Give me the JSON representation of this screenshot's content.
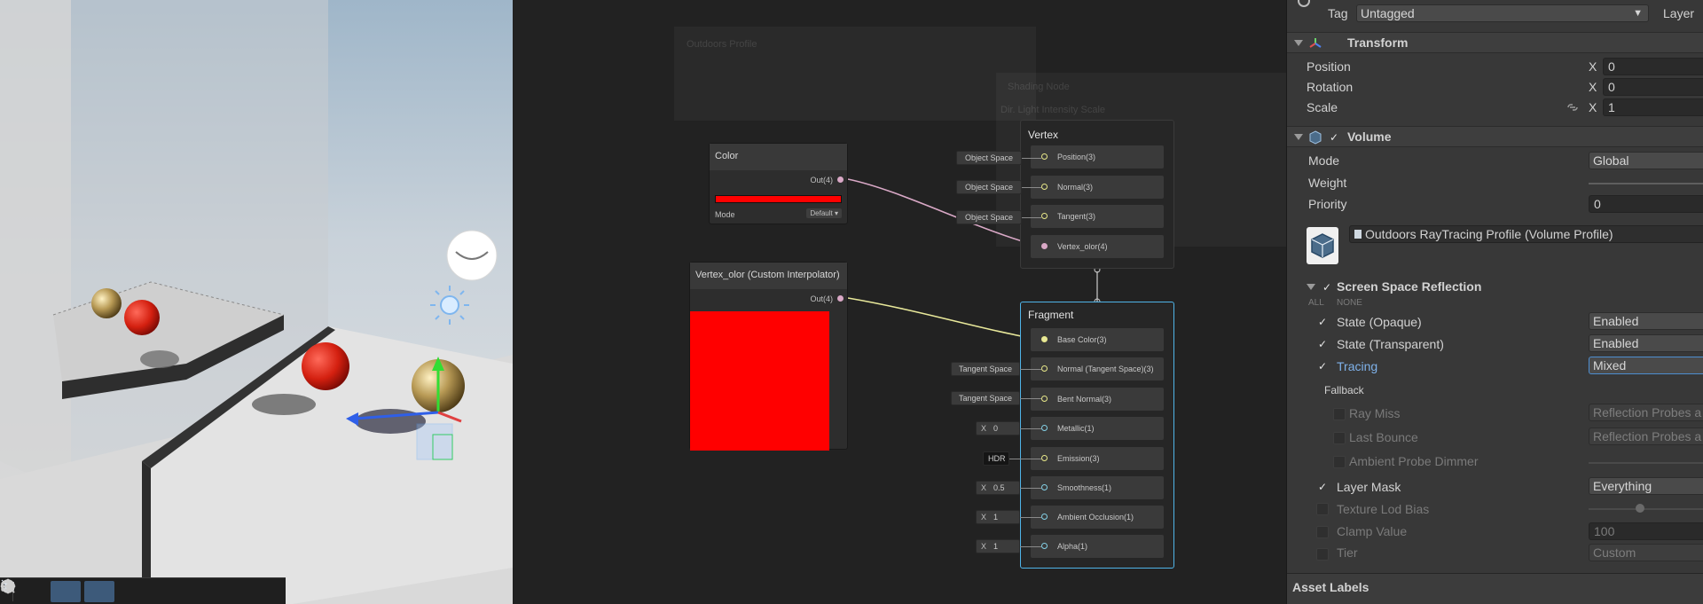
{
  "toolbar": {
    "tools": [
      {
        "icon": "move-view-icon"
      },
      {
        "icon": "sliders-icon"
      },
      {
        "icon": "grid-icon"
      },
      {
        "icon": "shading-icon"
      },
      {
        "icon": "layers-icon"
      },
      {
        "icon": "search-icon"
      },
      {
        "icon": "orbit-icon"
      },
      {
        "icon": "camera-icon"
      }
    ]
  },
  "graph": {
    "ghost_title_1": "Outdoors Profile",
    "ghost_title_2": "Shading Node",
    "ghost_sub": "Dir. Light Intensity Scale",
    "color_node": {
      "title": "Color",
      "out_label": "Out(4)",
      "mode_label": "Mode",
      "mode_value": "Default",
      "swatch_color": "#ff0000"
    },
    "vertex_color_node": {
      "title": "Vertex_olor (Custom Interpolator)",
      "out_label": "Out(4)",
      "preview_color": "#ff0000"
    },
    "vertex_stack": {
      "title": "Vertex",
      "slots": [
        {
          "label": "Position(3)",
          "chip": "Object Space"
        },
        {
          "label": "Normal(3)",
          "chip": "Object Space"
        },
        {
          "label": "Tangent(3)",
          "chip": "Object Space"
        },
        {
          "label": "Vertex_olor(4)",
          "chip": ""
        }
      ]
    },
    "fragment_stack": {
      "title": "Fragment",
      "slots": [
        {
          "label": "Base Color(3)",
          "chip_x": "",
          "chip": ""
        },
        {
          "label": "Normal (Tangent Space)(3)",
          "chip_x": "",
          "chip": "Tangent Space"
        },
        {
          "label": "Bent Normal(3)",
          "chip_x": "",
          "chip": "Tangent Space"
        },
        {
          "label": "Metallic(1)",
          "chip_x": "X",
          "chip": "0"
        },
        {
          "label": "Emission(3)",
          "chip_x": "",
          "chip": "HDR"
        },
        {
          "label": "Smoothness(1)",
          "chip_x": "X",
          "chip": "0.5"
        },
        {
          "label": "Ambient Occlusion(1)",
          "chip_x": "X",
          "chip": "1"
        },
        {
          "label": "Alpha(1)",
          "chip_x": "X",
          "chip": "1"
        }
      ]
    },
    "colors": {
      "accent": "#4fb4e8",
      "wire_color": "#d9a8c6",
      "wire_float": "#e8e89a"
    }
  },
  "inspector": {
    "tag_label": "Tag",
    "tag_value": "Untagged",
    "layer_label": "Layer",
    "transform": {
      "title": "Transform",
      "rows": [
        {
          "label": "Position",
          "axis": "X",
          "value": "0"
        },
        {
          "label": "Rotation",
          "axis": "X",
          "value": "0"
        },
        {
          "label": "Scale",
          "axis": "X",
          "value": "1"
        }
      ]
    },
    "volume": {
      "title": "Volume",
      "mode_label": "Mode",
      "mode_value": "Global",
      "weight_label": "Weight",
      "priority_label": "Priority",
      "priority_value": "0",
      "profile_value": "Outdoors RayTracing Profile (Volume Profile)"
    },
    "ssr": {
      "title": "Screen Space Reflection",
      "all_label": "ALL",
      "none_label": "NONE",
      "fallback_label": "Fallback",
      "rows": [
        {
          "label": "State (Opaque)",
          "value": "Enabled"
        },
        {
          "label": "State (Transparent)",
          "value": "Enabled"
        },
        {
          "label": "Tracing",
          "value": "Mixed"
        },
        {
          "label": "Ray Miss",
          "value": "Reflection Probes a"
        },
        {
          "label": "Last Bounce",
          "value": "Reflection Probes a"
        },
        {
          "label": "Ambient Probe Dimmer",
          "value": ""
        },
        {
          "label": "Layer Mask",
          "value": "Everything"
        },
        {
          "label": "Texture Lod Bias",
          "value": ""
        },
        {
          "label": "Clamp Value",
          "value": "100"
        },
        {
          "label": "Tier",
          "value": "Custom"
        }
      ]
    },
    "asset_labels": "Asset Labels"
  }
}
